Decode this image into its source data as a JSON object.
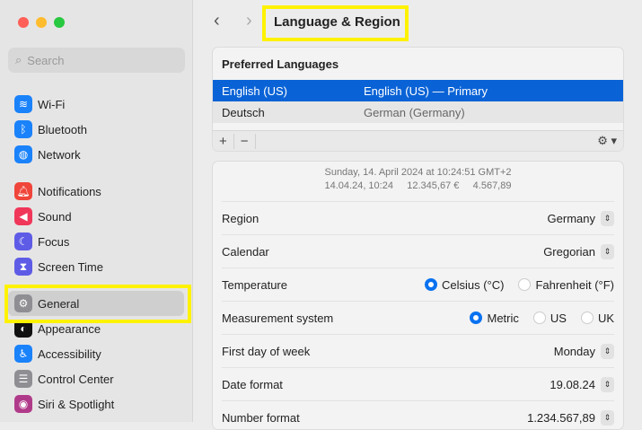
{
  "sidebar": {
    "search_placeholder": "Search",
    "items": [
      {
        "label": "Wi-Fi",
        "icon": "wifi-icon",
        "color": "#1a82fb"
      },
      {
        "label": "Bluetooth",
        "icon": "bluetooth-icon",
        "color": "#1a82fb"
      },
      {
        "label": "Network",
        "icon": "globe-icon",
        "color": "#1a82fb"
      },
      {
        "label": "Notifications",
        "icon": "bell-icon",
        "color": "#f0453a"
      },
      {
        "label": "Sound",
        "icon": "speaker-icon",
        "color": "#f0375a"
      },
      {
        "label": "Focus",
        "icon": "moon-icon",
        "color": "#5e5ce6"
      },
      {
        "label": "Screen Time",
        "icon": "hourglass-icon",
        "color": "#5e5ce6"
      },
      {
        "label": "General",
        "icon": "gear-icon",
        "color": "#8e8e93"
      },
      {
        "label": "Appearance",
        "icon": "appearance-icon",
        "color": "#111111"
      },
      {
        "label": "Accessibility",
        "icon": "accessibility-icon",
        "color": "#1a82fb"
      },
      {
        "label": "Control Center",
        "icon": "toggles-icon",
        "color": "#8e8e93"
      },
      {
        "label": "Siri & Spotlight",
        "icon": "siri-icon",
        "color": "#b03a8a"
      }
    ]
  },
  "header": {
    "title": "Language & Region"
  },
  "languages": {
    "title": "Preferred Languages",
    "rows": [
      {
        "name": "English (US)",
        "detail": "English (US) — Primary"
      },
      {
        "name": "Deutsch",
        "detail": "German (Germany)"
      }
    ],
    "add": "+",
    "remove": "−"
  },
  "preview": {
    "line1": "Sunday, 14. April 2024 at 10:24:51 GMT+2",
    "date": "14.04.24, 10:24",
    "currency": "12.345,67 €",
    "number": "4.567,89"
  },
  "settings": {
    "region": {
      "label": "Region",
      "value": "Germany"
    },
    "calendar": {
      "label": "Calendar",
      "value": "Gregorian"
    },
    "temperature": {
      "label": "Temperature",
      "options": [
        "Celsius (°C)",
        "Fahrenheit (°F)"
      ],
      "selected": "Celsius (°C)"
    },
    "measurement": {
      "label": "Measurement system",
      "options": [
        "Metric",
        "US",
        "UK"
      ],
      "selected": "Metric"
    },
    "first_day": {
      "label": "First day of week",
      "value": "Monday"
    },
    "date_format": {
      "label": "Date format",
      "value": "19.08.24"
    },
    "number_format": {
      "label": "Number format",
      "value": "1.234.567,89"
    }
  }
}
